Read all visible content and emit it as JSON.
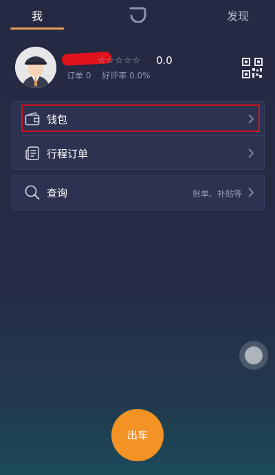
{
  "top_tabs": {
    "me": "我",
    "discover": "发现"
  },
  "profile": {
    "stars": "☆☆☆☆☆",
    "score": "0.0",
    "orders_label": "订单 0",
    "rating_label": "好评率 0.0%"
  },
  "menu": {
    "wallet": "钱包",
    "trip_orders": "行程订单",
    "query": "查询",
    "query_hint": "账单、补贴等"
  },
  "drive_button": "出车",
  "colors": {
    "accent": "#f39225",
    "tab_underline": "#e8a15a",
    "highlight": "#d6121c"
  }
}
